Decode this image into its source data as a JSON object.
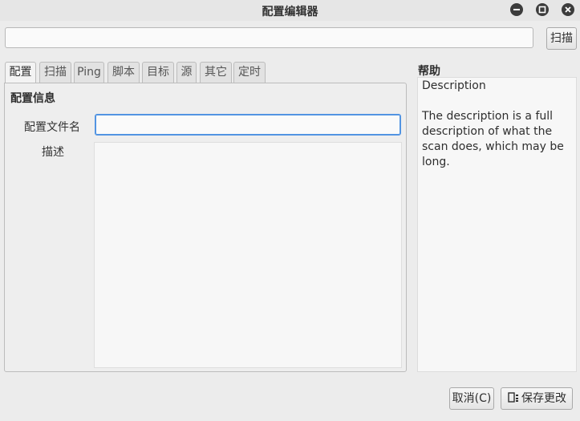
{
  "window": {
    "title": "配置编辑器",
    "controls": [
      "minimize-icon",
      "maximize-icon",
      "close-icon"
    ]
  },
  "command": {
    "value": "",
    "scan_label": "扫描"
  },
  "tabs": [
    {
      "label": "配置",
      "active": true
    },
    {
      "label": "扫描",
      "active": false
    },
    {
      "label": "Ping",
      "active": false
    },
    {
      "label": "脚本",
      "active": false
    },
    {
      "label": "目标",
      "active": false
    },
    {
      "label": "源",
      "active": false
    },
    {
      "label": "其它",
      "active": false
    },
    {
      "label": "定时",
      "active": false
    }
  ],
  "profile": {
    "heading": "配置信息",
    "name_label": "配置文件名",
    "name_value": "",
    "desc_label": "描述",
    "desc_value": ""
  },
  "help": {
    "heading": "帮助",
    "title": "Description",
    "text": "The description is a full description of what the scan does, which may be long."
  },
  "footer": {
    "cancel_label": "取消(C)",
    "save_label": "保存更改",
    "save_icon": "save-icon"
  },
  "colors": {
    "focus_border": "#5294e2",
    "window_bg": "#ececec"
  }
}
